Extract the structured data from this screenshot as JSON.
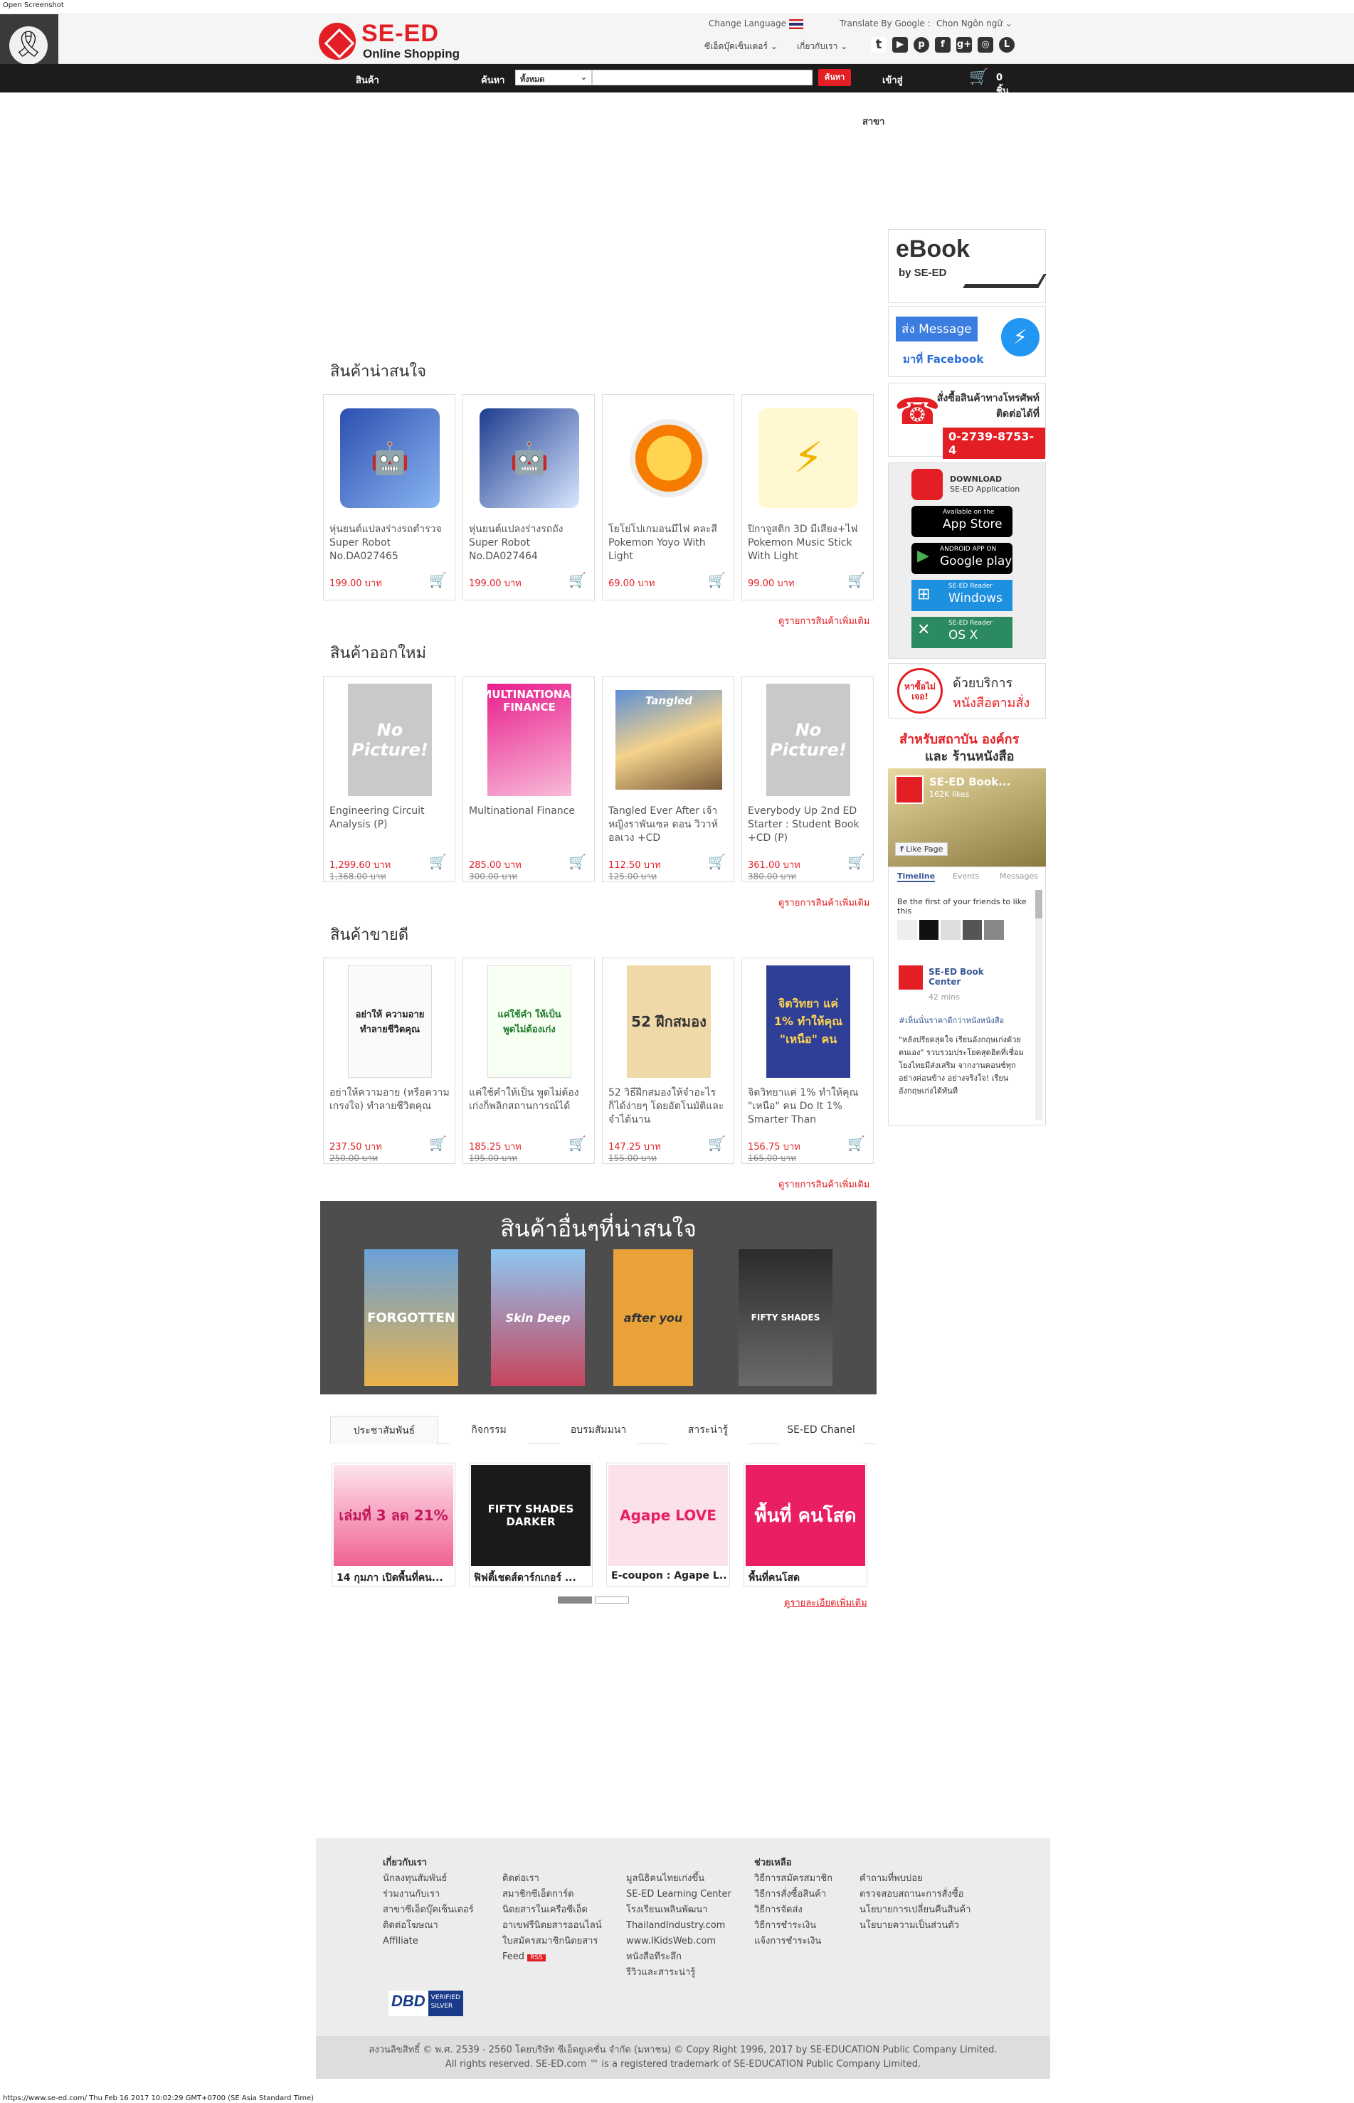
{
  "browser": {
    "top_label": "Open Screenshot",
    "bottom_status": "https://www.se-ed.com/  Thu Feb 16 2017 10:02:29 GMT+0700 (SE Asia Standard Time)"
  },
  "header": {
    "logo_title": "SE-ED",
    "logo_sub": "Online Shopping",
    "change_language": "Change Language",
    "translate_by": "Translate By Google :",
    "choose_lang": "Chon Ngôn ngữ",
    "link_center": "ซีเอ็ดบุ๊คเซ็นเตอร์",
    "link_about": "เกี่ยวกับเรา",
    "social": [
      "twitter-icon",
      "youtube-icon",
      "pinterest-icon",
      "facebook-icon",
      "google-plus-icon",
      "instagram-icon",
      "line-icon"
    ]
  },
  "nav": {
    "categories": "สินค้าและบริการ",
    "search_label": "ค้นหา",
    "search_select": "ทั้งหมด",
    "search_button": "ค้นหา",
    "login": "เข้าสู่ระบบ",
    "cart_count": "0",
    "cart_unit": "ชิ้น"
  },
  "branch_label": "สาขา",
  "sections": {
    "interesting": {
      "title": "สินค้าน่าสนใจ",
      "more": "ดูรายการสินค้าเพิ่มเติม",
      "items": [
        {
          "name": "หุ่นยนต์แปลงร่างรถตำรวจ Super Robot No.DA027465",
          "price": "199.00 บาท"
        },
        {
          "name": "หุ่นยนต์แปลงร่างรถถัง Super Robot No.DA027464",
          "price": "199.00 บาท"
        },
        {
          "name": "โยโย่โปเกมอนมีไฟ คละสี Pokemon Yoyo With Light",
          "price": "69.00 บาท"
        },
        {
          "name": "ปิกาจูสติก 3D มีเสียง+ไฟ Pokemon Music Stick With Light",
          "price": "99.00 บาท"
        }
      ]
    },
    "new": {
      "title": "สินค้าออกใหม่",
      "more": "ดูรายการสินค้าเพิ่มเติม",
      "items": [
        {
          "name": "Engineering Circuit Analysis (P)",
          "price": "1,299.60 บาท",
          "old": "1,368.00 บาท"
        },
        {
          "name": "Multinational Finance",
          "price": "285.00 บาท",
          "old": "300.00 บาท"
        },
        {
          "name": "Tangled Ever After เจ้าหญิงราพันเซล ตอน วิวาห์อลเวง +CD",
          "price": "112.50 บาท",
          "old": "125.00 บาท"
        },
        {
          "name": "Everybody Up 2nd ED Starter : Student Book +CD (P)",
          "price": "361.00 บาท",
          "old": "380.00 บาท"
        }
      ]
    },
    "best": {
      "title": "สินค้าขายดี",
      "more": "ดูรายการสินค้าเพิ่มเติม",
      "items": [
        {
          "name": "อย่าให้ความอาย (หรือความเกรงใจ) ทำลายชีวิตคุณ",
          "price": "237.50 บาท",
          "old": "250.00 บาท"
        },
        {
          "name": "แค่ใช้คำให้เป็น พูดไม่ต้องเก่งก็พลิกสถานการณ์ได้",
          "price": "185.25 บาท",
          "old": "195.00 บาท"
        },
        {
          "name": "52 วิธีฝึกสมองให้จำอะไรก็ได้ง่ายๆ โดยอัตโนมัติและจำได้นาน",
          "price": "147.25 บาท",
          "old": "155.00 บาท"
        },
        {
          "name": "จิตวิทยาแค่ 1% ทำให้คุณ \"เหนือ\" คน Do It 1% Smarter Than",
          "price": "156.75 บาท",
          "old": "165.00 บาท"
        }
      ]
    }
  },
  "covers": {
    "no_picture": "No Picture!",
    "finance": "MULTINATIONAL FINANCE",
    "tangled": "Tangled",
    "book1": "อย่าให้ ความอาย ทำลายชีวิตคุณ",
    "book2": "แค่ใช้คำ ให้เป็น พูดไม่ต้องเก่ง",
    "book3": "52 ฝึกสมอง",
    "book4": "จิตวิทยา แค่ 1% ทำให้คุณ \"เหนือ\" คน"
  },
  "other": {
    "title": "สินค้าอื่นๆที่น่าสนใจ",
    "books": [
      "FORGOTTEN",
      "Skin Deep",
      "after you",
      "FIFTY SHADES"
    ]
  },
  "tabs": [
    "ประชาสัมพันธ์",
    "กิจกรรม",
    "อบรมสัมมนา",
    "สาระน่ารู้",
    "SE-ED Chanel"
  ],
  "promos": [
    {
      "caption": "14 กุมภา เปิดพื้นที่คน...",
      "art": "เล่มที่ 3 ลด 21%",
      "color": "#f06292"
    },
    {
      "caption": "ฟิฟตี้เชดส์ดาร์กเกอร์ ...",
      "art": "FIFTY SHADES DARKER",
      "color": "#1a1a1a"
    },
    {
      "caption": "E-coupon : Agape L...",
      "art": "Agape LOVE",
      "color": "#f48fb1"
    },
    {
      "caption": "พื้นที่คนโสด",
      "art": "พื้นที่ คนโสด",
      "color": "#e91e63"
    }
  ],
  "promo_more": "ดูรายละเอียดเพิ่มเติม",
  "sidebar": {
    "ebook_title": "eBook",
    "ebook_sub": "by SE-ED",
    "messenger_line1": "ส่ง Message",
    "messenger_line2": "มาที่ Facebook",
    "phone_line1": "สั่งซื้อสินค้าทางโทรศัพท์",
    "phone_line2": "ติดต่อได้ที่",
    "phone_number": "0-2739-8753-4",
    "download": "DOWNLOAD",
    "se_ed_app": "SE-ED Application",
    "appstore_small": "Available on the",
    "appstore": "App Store",
    "googleplay_small": "ANDROID APP ON",
    "googleplay": "Google play",
    "windows_small": "SE-ED Reader",
    "windows": "Windows",
    "osx_small": "SE-ED Reader",
    "osx": "OS X",
    "order_badge": "หาซื้อไม่เจอ!",
    "order_text1": "ด้วยบริการ",
    "order_text2": "หนังสือตามสั่ง",
    "inst_line1": "สำหรับสถาบัน องค์กร",
    "inst_line2": "และ ร้านหนังสือ",
    "fb_page": "SE-ED Book...",
    "fb_likes": "162K likes",
    "fb_like_btn": "Like Page",
    "fb_tabs": [
      "Timeline",
      "Events",
      "Messages"
    ],
    "fb_friends": "Be the first of your friends to like this",
    "fb_post_author": "SE-ED Book Center",
    "fb_post_time": "42 mins",
    "fb_post_link": "#เห็นนั่นราคาดีกว่าหนังหนังสือ",
    "fb_post_text": "\"หลังปรียดสุดใจ เรียนอังกฤษเก่งด้วยตนเอง\" รวบรวมประโยคสุดฮิตที่เชื่อมโยงไทยมีส่งเสริม จากงานคอนซ์ทุกอย่างค่อนข้าง อย่างจริงใจ! เรียนอังกฤษเก่งได้ทันที"
  },
  "footer": {
    "col1": [
      "เกี่ยวกับเรา",
      "นักลงทุนสัมพันธ์",
      "ร่วมงานกับเรา",
      "สาขาซีเอ็ดบุ๊คเซ็นเตอร์",
      "ติดต่อโฆษณา",
      "Affiliate"
    ],
    "col2": [
      "ติดต่อเรา",
      "สมาชิกซีเอ็ดการ์ด",
      "นิตยสารในเครือซีเอ็ด",
      "อาเขฟรีนิตยสารออนไลน์",
      "ใบสมัครสมาชิกนิตยสาร",
      "Feed"
    ],
    "col3": [
      "มูลนิธิคนไทยเก่งขึ้น",
      "SE-ED Learning Center",
      "โรงเรียนเพลินพัฒนา",
      "ThailandIndustry.com",
      "www.IKidsWeb.com",
      "หนังสือทีระลึก",
      "รีวิวและสาระน่ารู้"
    ],
    "col4": [
      "ช่วยเหลือ",
      "วิธีการสมัครสมาชิก",
      "วิธีการสั่งซื้อสินค้า",
      "วิธีการจัดส่ง",
      "วิธีการชำระเงิน",
      "แจ้งการชำระเงิน"
    ],
    "col5": [
      "คำถามที่พบบ่อย",
      "ตรวจสอบสถานะการสั่งซื้อ",
      "นโยบายการเปลี่ยนคืนสินค้า",
      "นโยบายความเป็นส่วนตัว"
    ],
    "rss": "RSS",
    "dbd1": "DBD",
    "dbd2": "VERIFIED",
    "dbd3": "SILVER",
    "copyright1": "สงวนลิขสิทธิ์ © พ.ศ. 2539 - 2560 โดยบริษัท ซีเอ็ดยูเคชั่น จำกัด (มหาชน) © Copy Right 1996, 2017 by SE-EDUCATION Public Company Limited.",
    "copyright2": "All rights reserved. SE-ED.com ™ is a registered trademark of SE-EDUCATION Public Company Limited."
  }
}
